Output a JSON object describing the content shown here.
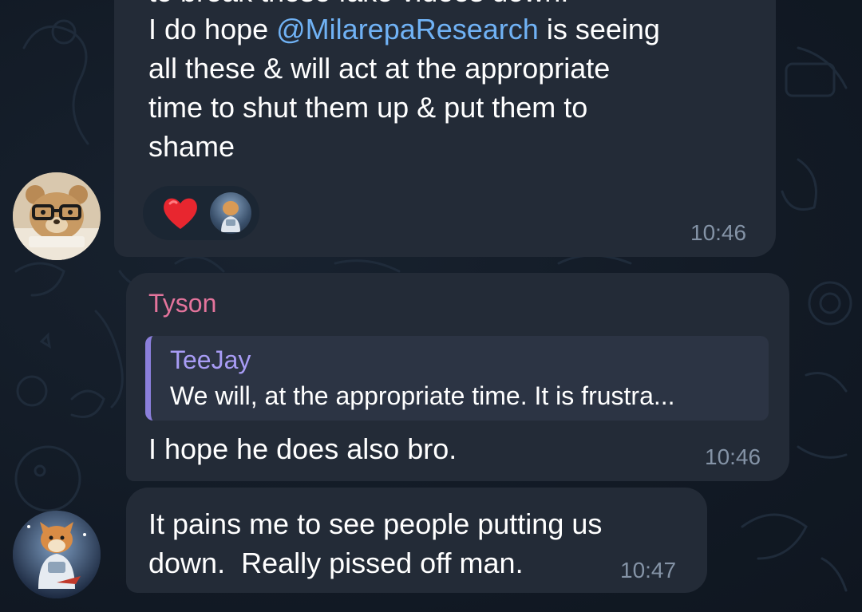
{
  "messages": [
    {
      "clipped_line": "to break those fake videos down.",
      "text_before_mention": "I do hope ",
      "mention": "@MilarepaResearch",
      "text_after_mention": " is seeing\nall these & will act at the appropriate\ntime to shut them up & put them to\nshame",
      "time": "10:46",
      "reactions": [
        "heart",
        "avatar"
      ]
    },
    {
      "sender": "Tyson",
      "reply_to": {
        "name": "TeeJay",
        "text": "We will, at the appropriate time. It is frustra..."
      },
      "text": "I hope he does also bro.",
      "time": "10:46"
    },
    {
      "text": "It pains me to see people putting us\ndown.  Really pissed off man.",
      "time": "10:47"
    }
  ],
  "colors": {
    "bubble": "#232b37",
    "mention": "#70b2f5",
    "sender_name": "#e4749c",
    "reply_accent": "#8b7fdb",
    "timestamp": "#8493a6"
  },
  "icons": [
    "heart-reaction-icon",
    "user-avatar-reaction",
    "bear-avatar",
    "shiba-astronaut-avatar"
  ]
}
